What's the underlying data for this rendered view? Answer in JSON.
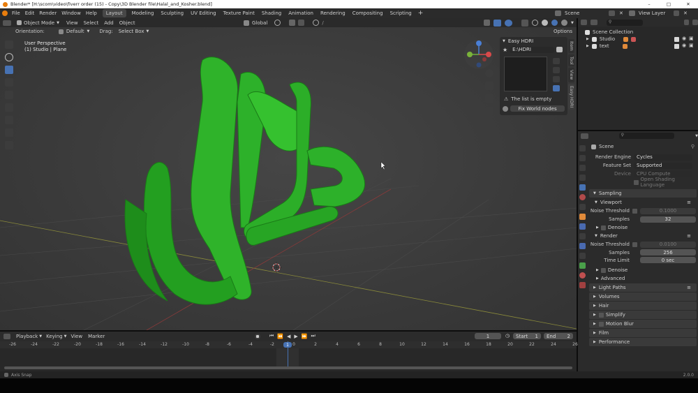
{
  "titlebar": {
    "title": "Blender* [H:\\scom\\video\\fiverr order (15) - Copy\\3D Blender file\\Halal_and_Kosher.blend]"
  },
  "menus": [
    "File",
    "Edit",
    "Render",
    "Window",
    "Help"
  ],
  "workspace_tabs": [
    "Layout",
    "Modeling",
    "Sculpting",
    "UV Editing",
    "Texture Paint",
    "Shading",
    "Animation",
    "Rendering",
    "Compositing",
    "Scripting"
  ],
  "active_tab": "Layout",
  "scene_name": "Scene",
  "view_layer": "View Layer",
  "viewport_header": {
    "mode": "Object Mode",
    "menu": [
      "View",
      "Select",
      "Add",
      "Object"
    ],
    "transform_space": "Global"
  },
  "tool_settings": {
    "orientation_label": "Orientation:",
    "orientation_value": "Default",
    "drag_label": "Drag:",
    "drag_value": "Select Box",
    "options": "Options"
  },
  "viewport_overlay": {
    "line1": "User Perspective",
    "line2": "(1) Studio | Plane"
  },
  "npanel": {
    "title": "Easy HDRI",
    "folder_value": "E:\\HDRI",
    "empty_msg": "The list is empty",
    "fix_btn": "Fix World nodes",
    "tabs": [
      "Item",
      "Tool",
      "View",
      "Easy HDRI"
    ]
  },
  "outliner": {
    "root": "Scene Collection",
    "items": [
      {
        "name": "Studio"
      },
      {
        "name": "text"
      }
    ]
  },
  "properties": {
    "scene_label": "Scene",
    "render_engine_label": "Render Engine",
    "render_engine": "Cycles",
    "feature_set_label": "Feature Set",
    "feature_set": "Supported",
    "device_label": "Device",
    "device": "CPU Compute",
    "osl_label": "Open Shading Language",
    "sampling": "Sampling",
    "viewport": "Viewport",
    "noise_threshold_label": "Noise Threshold",
    "vp_noise_value": "0.1000",
    "samples_label": "Samples",
    "vp_samples": "32",
    "denoise": "Denoise",
    "render": "Render",
    "r_noise_value": "0.0100",
    "r_samples": "256",
    "time_limit_label": "Time Limit",
    "time_limit": "0 sec",
    "advanced": "Advanced",
    "sections": [
      "Light Paths",
      "Volumes",
      "Hair",
      "Simplify",
      "Motion Blur",
      "Film",
      "Performance"
    ]
  },
  "timeline": {
    "menu": [
      "Playback",
      "Keying",
      "View",
      "Marker"
    ],
    "current_frame": "1",
    "start_label": "Start",
    "start": "1",
    "end_label": "End",
    "end": "2",
    "ticks": [
      "-26",
      "-24",
      "-22",
      "-20",
      "-18",
      "-16",
      "-14",
      "-12",
      "-10",
      "-8",
      "-6",
      "-4",
      "-2",
      "0",
      "2",
      "4",
      "6",
      "8",
      "10",
      "12",
      "14",
      "16",
      "18",
      "20",
      "22",
      "24",
      "26"
    ],
    "playhead": "1"
  },
  "statusbar": {
    "left": "Axis Snap",
    "right": "2.0.0"
  },
  "colors": {
    "accent": "#4772b3",
    "object_green": "#2fb32a"
  }
}
